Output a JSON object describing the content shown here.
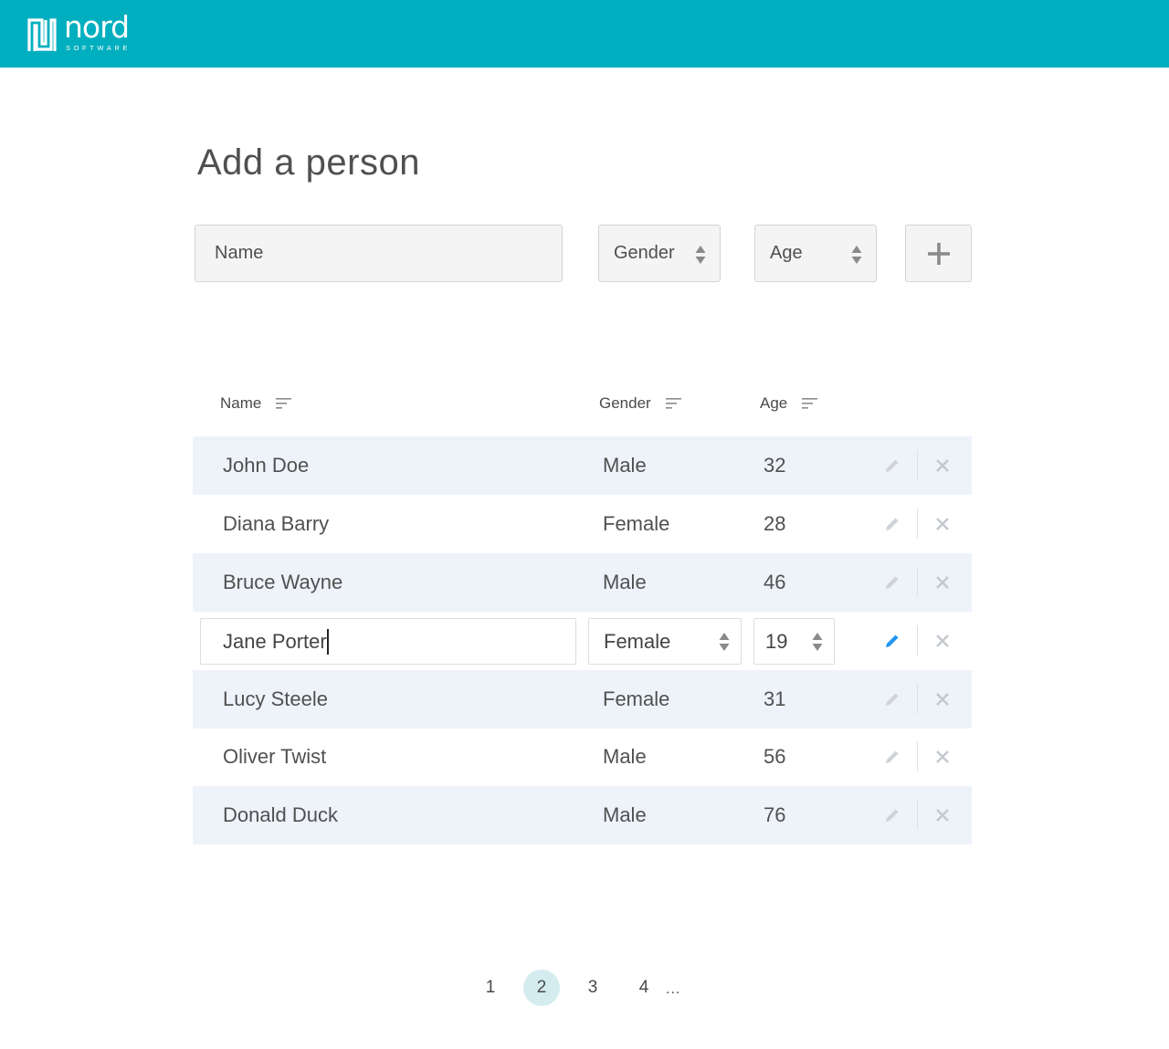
{
  "brand": {
    "name": "nord",
    "tagline": "SOFTWARE",
    "color": "#00afbf"
  },
  "page": {
    "title": "Add a person"
  },
  "form": {
    "name_placeholder": "Name",
    "gender_placeholder": "Gender",
    "age_placeholder": "Age",
    "add_icon": "plus-icon"
  },
  "table": {
    "columns": [
      "Name",
      "Gender",
      "Age"
    ],
    "rows": [
      {
        "name": "John Doe",
        "gender": "Male",
        "age": "32",
        "editing": false
      },
      {
        "name": "Diana Barry",
        "gender": "Female",
        "age": "28",
        "editing": false
      },
      {
        "name": "Bruce Wayne",
        "gender": "Male",
        "age": "46",
        "editing": false
      },
      {
        "name": "Jane Porter",
        "gender": "Female",
        "age": "19",
        "editing": true
      },
      {
        "name": "Lucy Steele",
        "gender": "Female",
        "age": "31",
        "editing": false
      },
      {
        "name": "Oliver Twist",
        "gender": "Male",
        "age": "56",
        "editing": false
      },
      {
        "name": "Donald Duck",
        "gender": "Male",
        "age": "76",
        "editing": false
      }
    ],
    "row_shade_color": "#eef3fa",
    "edit_active_color": "#2196f3"
  },
  "pagination": {
    "pages": [
      "1",
      "2",
      "3",
      "4"
    ],
    "current": "2",
    "ellipsis": "..."
  }
}
